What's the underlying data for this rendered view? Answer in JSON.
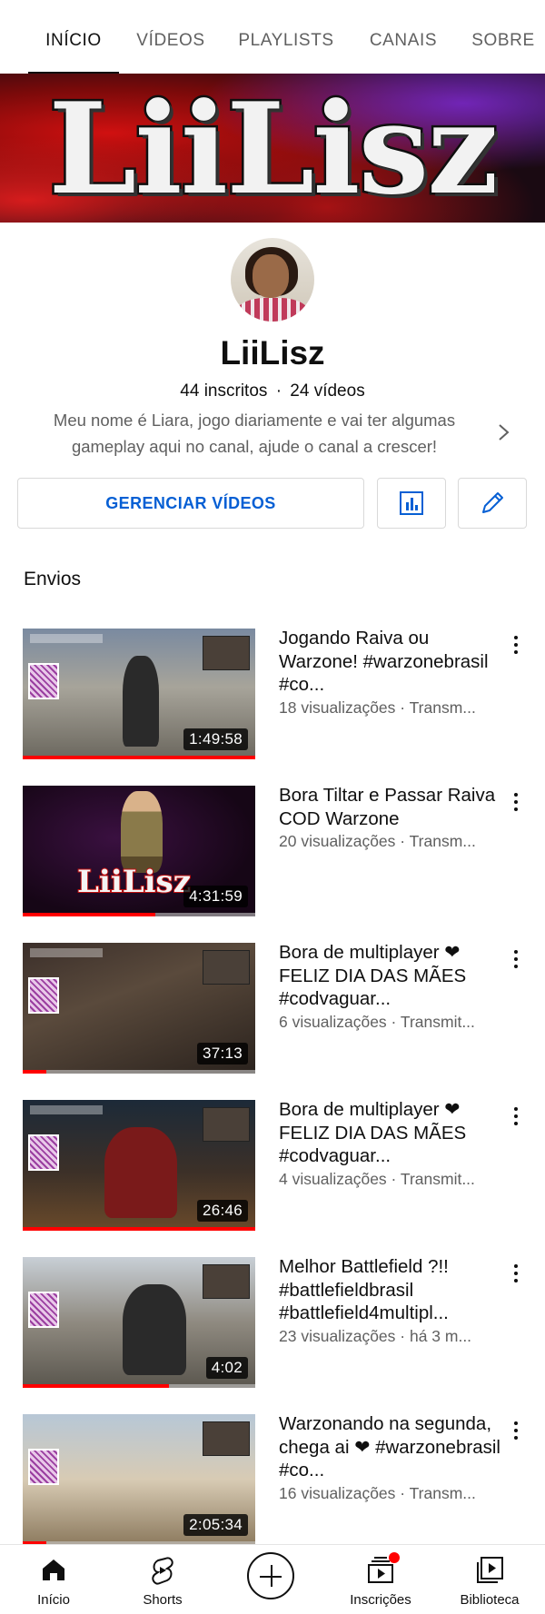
{
  "tabs": [
    {
      "label": "INÍCIO",
      "active": true
    },
    {
      "label": "VÍDEOS"
    },
    {
      "label": "PLAYLISTS"
    },
    {
      "label": "CANAIS"
    },
    {
      "label": "SOBRE"
    }
  ],
  "banner": {
    "text": "LiiLisz"
  },
  "channel": {
    "name": "LiiLisz",
    "subscribers": "44 inscritos",
    "separator": "·",
    "video_count": "24 vídeos",
    "description": "Meu nome é Liara,  jogo diariamente e vai ter algumas gameplay aqui no canal, ajude o canal a crescer!"
  },
  "actions": {
    "manage_label": "GERENCIAR VÍDEOS",
    "stats_icon": "bar-chart-icon",
    "edit_icon": "pencil-icon",
    "accent": "#065fd4"
  },
  "uploads": {
    "section_title": "Envios",
    "videos": [
      {
        "title": "Jogando Raiva ou Warzone! #warzonebrasil #co...",
        "meta": "18 visualizações · Transm...",
        "duration": "1:49:58",
        "watched": 1.0
      },
      {
        "title": "Bora Tiltar e Passar Raiva COD Warzone",
        "meta": "20 visualizações · Transm...",
        "duration": "4:31:59",
        "watched": 0.57
      },
      {
        "title": "Bora de multiplayer ❤ FELIZ DIA DAS MÃES #codvaguar...",
        "meta": "6 visualizações · Transmit...",
        "duration": "37:13",
        "watched": 0.1
      },
      {
        "title": "Bora de multiplayer ❤ FELIZ DIA DAS MÃES #codvaguar...",
        "meta": "4 visualizações · Transmit...",
        "duration": "26:46",
        "watched": 1.0
      },
      {
        "title": "Melhor Battlefield ?!! #battlefieldbrasil #battlefield4multipl...",
        "meta": "23 visualizações · há 3 m...",
        "duration": "4:02",
        "watched": 0.63
      },
      {
        "title": "Warzonando na segunda, chega ai ❤ #warzonebrasil #co...",
        "meta": "16 visualizações · Transm...",
        "duration": "2:05:34",
        "watched": 0.1
      }
    ]
  },
  "bottom_nav": [
    {
      "label": "Início",
      "icon": "home-icon",
      "active": true
    },
    {
      "label": "Shorts",
      "icon": "shorts-icon"
    },
    {
      "label": "",
      "icon": "create-icon"
    },
    {
      "label": "Inscrições",
      "icon": "subscriptions-icon",
      "has_notification": true
    },
    {
      "label": "Biblioteca",
      "icon": "library-icon"
    }
  ]
}
